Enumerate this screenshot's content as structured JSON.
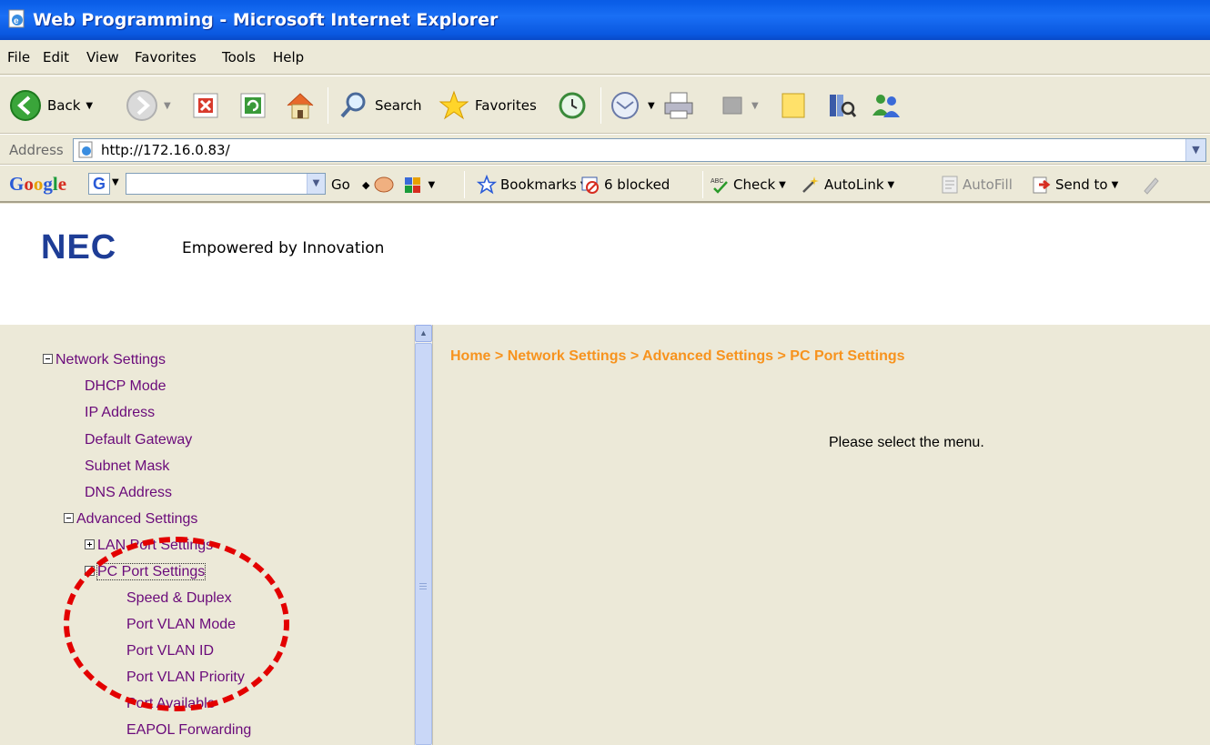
{
  "window": {
    "title": "Web Programming - Microsoft Internet Explorer"
  },
  "menubar": {
    "items": [
      "File",
      "Edit",
      "View",
      "Favorites",
      "Tools",
      "Help"
    ]
  },
  "toolbar": {
    "back_label": "Back",
    "search_label": "Search",
    "favorites_label": "Favorites"
  },
  "address": {
    "label": "Address",
    "url": "http://172.16.0.83/"
  },
  "googlebar": {
    "logo": "Google",
    "g_icon": "G",
    "go_label": "Go",
    "bookmarks_label": "Bookmarks",
    "blocked_label": "6 blocked",
    "check_label": "Check",
    "autolink_label": "AutoLink",
    "autofill_label": "AutoFill",
    "sendto_label": "Send to"
  },
  "page": {
    "logo": "NEC",
    "tagline": "Empowered by Innovation",
    "breadcrumb": "Home > Network Settings > Advanced Settings > PC Port Settings",
    "message": "Please select the menu.",
    "tree": {
      "network_settings": "Network Settings",
      "dhcp_mode": "DHCP Mode",
      "ip_address": "IP Address",
      "default_gateway": "Default Gateway",
      "subnet_mask": "Subnet Mask",
      "dns_address": "DNS Address",
      "advanced_settings": "Advanced Settings",
      "lan_port_settings": "LAN Port Settings",
      "pc_port_settings": "PC Port Settings",
      "speed_duplex": "Speed & Duplex",
      "port_vlan_mode": "Port VLAN Mode",
      "port_vlan_id": "Port VLAN ID",
      "port_vlan_priority": "Port VLAN Priority",
      "port_available": "Port Available",
      "eapol_forwarding": "EAPOL Forwarding"
    }
  },
  "colors": {
    "titlebar": "#0a5ce6",
    "tree_link": "#6a0a7a",
    "breadcrumb": "#f7931e",
    "nec_blue": "#1e3d96",
    "annotation": "#e30000"
  }
}
